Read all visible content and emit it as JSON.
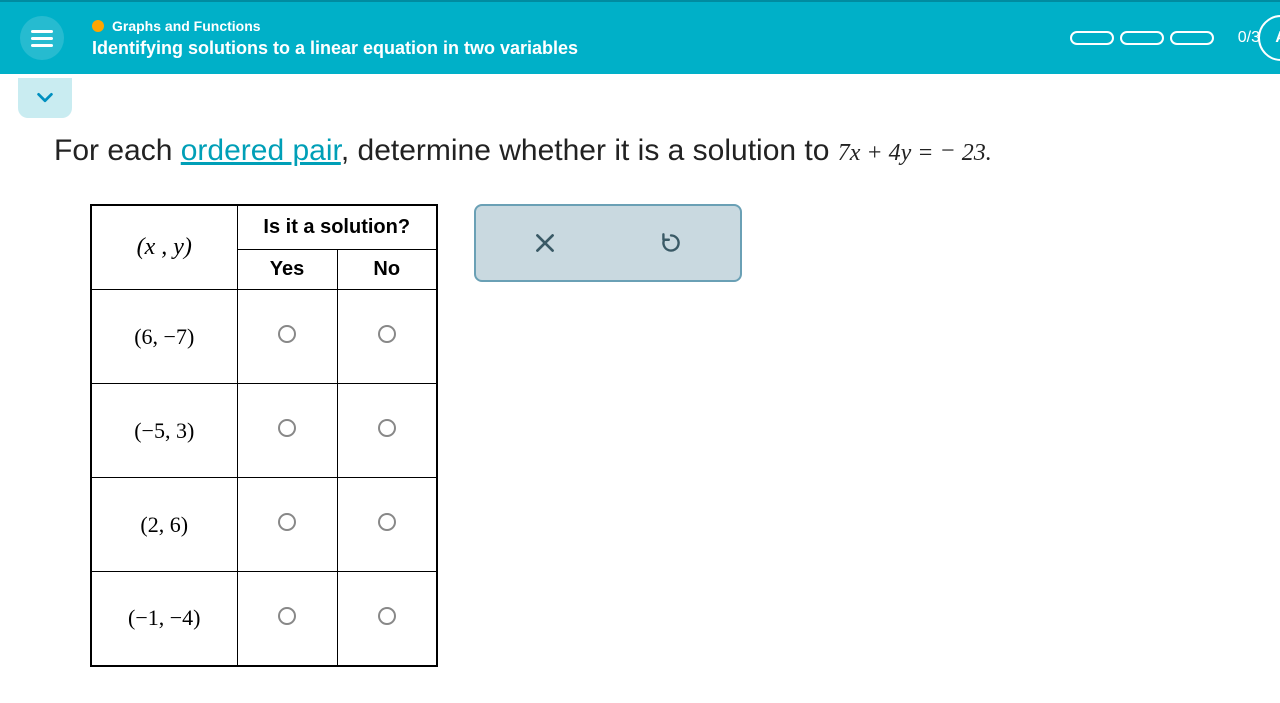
{
  "header": {
    "category": "Graphs and Functions",
    "topic": "Identifying solutions to a linear equation in two variables",
    "progress_text": "0/3",
    "side_label": "A"
  },
  "question": {
    "prefix": "For each ",
    "link_text": "ordered pair",
    "middle": ", determine whether it is a solution to ",
    "equation": "7x + 4y = − 23.",
    "equation_html": "7<span style='font-style:italic'>x</span> + 4<span style='font-style:italic'>y</span> = − 23."
  },
  "table": {
    "header_pair": "(x , y)",
    "header_question": "Is it a solution?",
    "col_yes": "Yes",
    "col_no": "No",
    "rows": [
      {
        "pair": "(6, −7)"
      },
      {
        "pair": "(−5, 3)"
      },
      {
        "pair": "(2, 6)"
      },
      {
        "pair": "(−1, −4)"
      }
    ]
  },
  "icons": {
    "menu": "menu-icon",
    "close": "close-icon",
    "reset": "reset-icon",
    "chevron": "chevron-down-icon"
  }
}
